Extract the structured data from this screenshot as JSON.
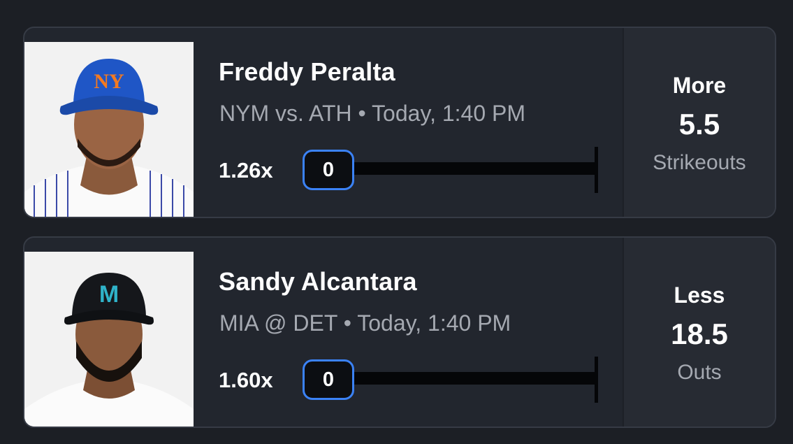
{
  "picks": [
    {
      "player": "Freddy Peralta",
      "matchup": "NYM vs. ATH • Today, 1:40 PM",
      "multiplier": "1.26x",
      "progress": "0",
      "direction": "More",
      "line": "5.5",
      "stat": "Strikeouts",
      "team_logo_text": "NY",
      "cap_color": "#1f56c6",
      "logo_color": "#f47a20"
    },
    {
      "player": "Sandy Alcantara",
      "matchup": "MIA @ DET • Today, 1:40 PM",
      "multiplier": "1.60x",
      "progress": "0",
      "direction": "Less",
      "line": "18.5",
      "stat": "Outs",
      "team_logo_text": "M",
      "cap_color": "#15171b",
      "logo_color": "#2fb3c9"
    }
  ],
  "colors": {
    "background": "#1c1f25",
    "card": "#22262e",
    "accent_border": "#3b82f6",
    "muted_text": "#a5a9b1"
  }
}
